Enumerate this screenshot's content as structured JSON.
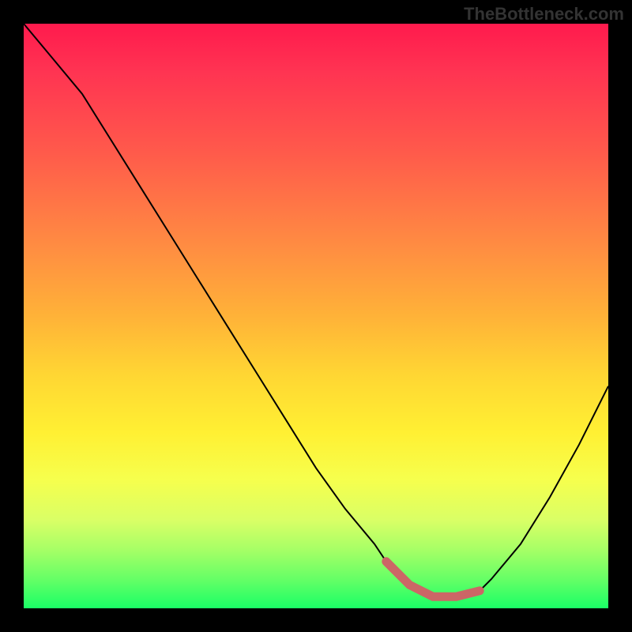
{
  "watermark": "TheBottleneck.com",
  "chart_data": {
    "type": "line",
    "title": "",
    "xlabel": "",
    "ylabel": "",
    "x_range": [
      0,
      100
    ],
    "y_range": [
      0,
      100
    ],
    "series": [
      {
        "name": "curve",
        "x": [
          0,
          5,
          10,
          15,
          20,
          25,
          30,
          35,
          40,
          45,
          50,
          55,
          60,
          62,
          66,
          70,
          74,
          78,
          80,
          85,
          90,
          95,
          100
        ],
        "values": [
          100,
          94,
          88,
          80,
          72,
          64,
          56,
          48,
          40,
          32,
          24,
          17,
          11,
          8,
          4,
          2,
          2,
          3,
          5,
          11,
          19,
          28,
          38
        ]
      }
    ],
    "highlight_segment": {
      "name": "optimal-range",
      "x": [
        62,
        66,
        70,
        74,
        78
      ],
      "values": [
        8,
        4,
        2,
        2,
        3
      ]
    },
    "colors": {
      "curve": "#000000",
      "highlight": "#cc6666",
      "gradient_top": "#ff1a4d",
      "gradient_mid": "#fff033",
      "gradient_bottom": "#1aff66",
      "background": "#000000"
    }
  }
}
